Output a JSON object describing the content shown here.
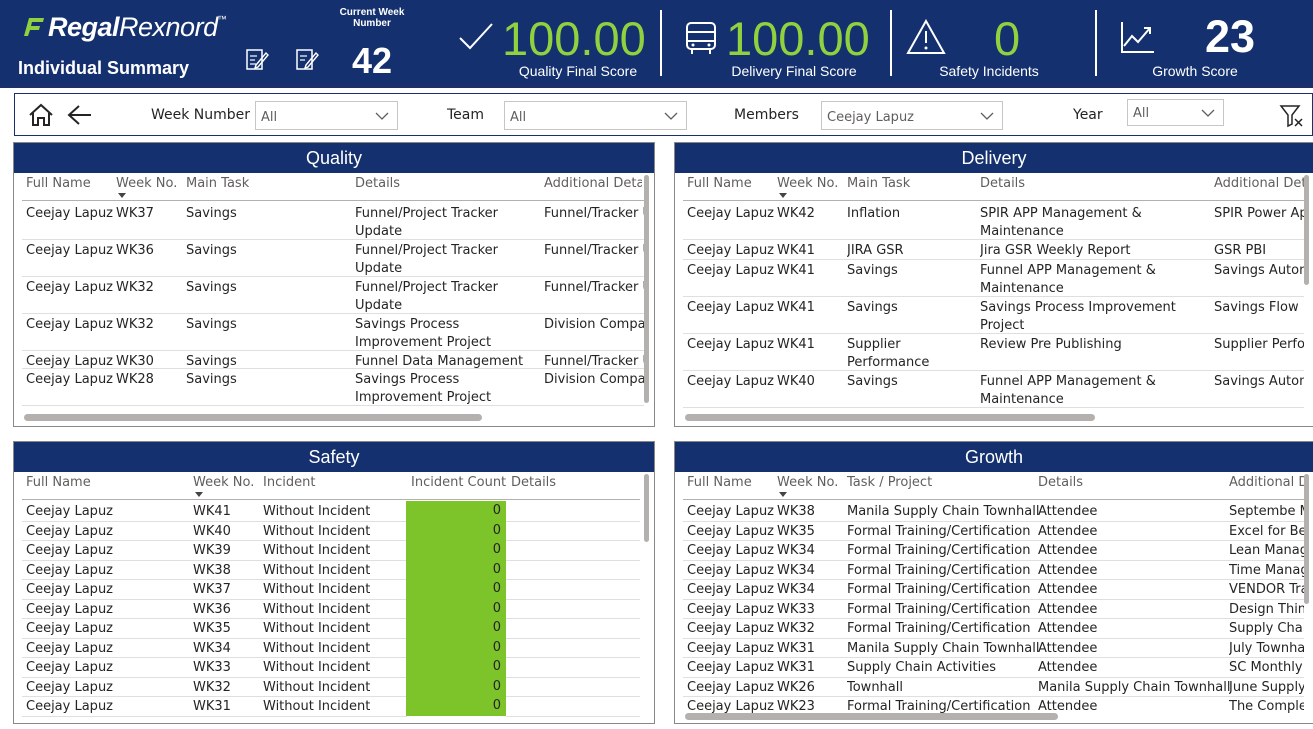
{
  "header": {
    "logo_part1": "Regal",
    "logo_part2": "Rexnord",
    "logo_tm": "™",
    "title": "Individual Summary",
    "current_week_label": "Current Week Number",
    "current_week_value": "42",
    "quality": {
      "value": "100.00",
      "label": "Quality Final Score"
    },
    "delivery": {
      "value": "100.00",
      "label": "Delivery Final Score"
    },
    "safety": {
      "value": "0",
      "label": "Safety Incidents"
    },
    "growth": {
      "value": "23",
      "label": "Growth Score"
    },
    "accent_color": "#8fd13f",
    "bg_color": "#14306e"
  },
  "filters": {
    "week": {
      "label": "Week Number",
      "value": "All"
    },
    "team": {
      "label": "Team",
      "value": "All"
    },
    "members": {
      "label": "Members",
      "value": "Ceejay Lapuz"
    },
    "year": {
      "label": "Year",
      "value": "All"
    }
  },
  "quality": {
    "title": "Quality",
    "headers": [
      "Full Name",
      "Week No.",
      "Main Task",
      "Details",
      "Additional Deta"
    ],
    "rows": [
      [
        "Ceejay Lapuz",
        "WK37",
        "Savings",
        "Funnel/Project Tracker",
        "Update",
        "Funnel/Tracker U"
      ],
      [
        "Ceejay Lapuz",
        "WK36",
        "Savings",
        "Funnel/Project Tracker",
        "Update",
        "Funnel/Tracker U"
      ],
      [
        "Ceejay Lapuz",
        "WK32",
        "Savings",
        "Funnel/Project Tracker",
        "Update",
        "Funnel/Tracker U"
      ],
      [
        "Ceejay Lapuz",
        "WK32",
        "Savings",
        "Savings Process",
        "Improvement Project",
        "Division Compar"
      ],
      [
        "Ceejay Lapuz",
        "WK30",
        "Savings",
        "Funnel Data Management",
        "",
        "Funnel/Tracker U"
      ],
      [
        "Ceejay Lapuz",
        "WK28",
        "Savings",
        "Savings Process",
        "Improvement Project",
        "Division Compar"
      ]
    ]
  },
  "delivery": {
    "title": "Delivery",
    "headers": [
      "Full Name",
      "Week No.",
      "Main Task",
      "Details",
      "Additional Deta"
    ],
    "rows": [
      [
        "Ceejay Lapuz",
        "WK42",
        "Inflation",
        "",
        "SPIR APP Management &",
        "Maintenance",
        "SPIR Power Ap"
      ],
      [
        "Ceejay Lapuz",
        "WK41",
        "JIRA GSR",
        "",
        "Jira GSR Weekly Report",
        "",
        "GSR PBI"
      ],
      [
        "Ceejay Lapuz",
        "WK41",
        "Savings",
        "",
        "Funnel APP Management &",
        "Maintenance",
        "Savings Autom"
      ],
      [
        "Ceejay Lapuz",
        "WK41",
        "Savings",
        "",
        "Savings Process Improvement",
        "Project",
        "Savings Flow"
      ],
      [
        "Ceejay Lapuz",
        "WK41",
        "Supplier",
        "Performance",
        "Review Pre Publishing",
        "",
        "Supplier Perfor"
      ],
      [
        "Ceejay Lapuz",
        "WK40",
        "Savings",
        "",
        "Funnel APP Management &",
        "Maintenance",
        "Savings Autom"
      ]
    ]
  },
  "safety": {
    "title": "Safety",
    "headers": [
      "Full Name",
      "Week No.",
      "Incident",
      "Incident Count",
      "Details"
    ],
    "rows": [
      [
        "Ceejay Lapuz",
        "WK41",
        "Without Incident",
        "0"
      ],
      [
        "Ceejay Lapuz",
        "WK40",
        "Without Incident",
        "0"
      ],
      [
        "Ceejay Lapuz",
        "WK39",
        "Without Incident",
        "0"
      ],
      [
        "Ceejay Lapuz",
        "WK38",
        "Without Incident",
        "0"
      ],
      [
        "Ceejay Lapuz",
        "WK37",
        "Without Incident",
        "0"
      ],
      [
        "Ceejay Lapuz",
        "WK36",
        "Without Incident",
        "0"
      ],
      [
        "Ceejay Lapuz",
        "WK35",
        "Without Incident",
        "0"
      ],
      [
        "Ceejay Lapuz",
        "WK34",
        "Without Incident",
        "0"
      ],
      [
        "Ceejay Lapuz",
        "WK33",
        "Without Incident",
        "0"
      ],
      [
        "Ceejay Lapuz",
        "WK32",
        "Without Incident",
        "0"
      ],
      [
        "Ceejay Lapuz",
        "WK31",
        "Without Incident",
        "0"
      ]
    ]
  },
  "growth": {
    "title": "Growth",
    "headers": [
      "Full Name",
      "Week No.",
      "Task / Project",
      "Details",
      "Additional D"
    ],
    "rows": [
      [
        "Ceejay Lapuz",
        "WK38",
        "Manila Supply Chain Townhall",
        "Attendee",
        "Septembe M"
      ],
      [
        "Ceejay Lapuz",
        "WK35",
        "Formal Training/Certification",
        "Attendee",
        "Excel for Beg"
      ],
      [
        "Ceejay Lapuz",
        "WK34",
        "Formal Training/Certification",
        "Attendee",
        "Lean Manag"
      ],
      [
        "Ceejay Lapuz",
        "WK34",
        "Formal Training/Certification",
        "Attendee",
        "Time Manag"
      ],
      [
        "Ceejay Lapuz",
        "WK34",
        "Formal Training/Certification",
        "Attendee",
        "VENDOR Tra"
      ],
      [
        "Ceejay Lapuz",
        "WK33",
        "Formal Training/Certification",
        "Attendee",
        "Design Think"
      ],
      [
        "Ceejay Lapuz",
        "WK32",
        "Formal Training/Certification",
        "Attendee",
        "Supply Chair"
      ],
      [
        "Ceejay Lapuz",
        "WK31",
        "Manila Supply Chain Townhall",
        "Attendee",
        "July Townhal"
      ],
      [
        "Ceejay Lapuz",
        "WK31",
        "Supply Chain Activities",
        "Attendee",
        "SC Monthly"
      ],
      [
        "Ceejay Lapuz",
        "WK26",
        "Townhall",
        "Manila Supply Chain Townhall",
        "June Supply"
      ],
      [
        "Ceejay Lapuz",
        "WK23",
        "Formal Training/Certification",
        "Attendee",
        "The Complet"
      ]
    ]
  }
}
